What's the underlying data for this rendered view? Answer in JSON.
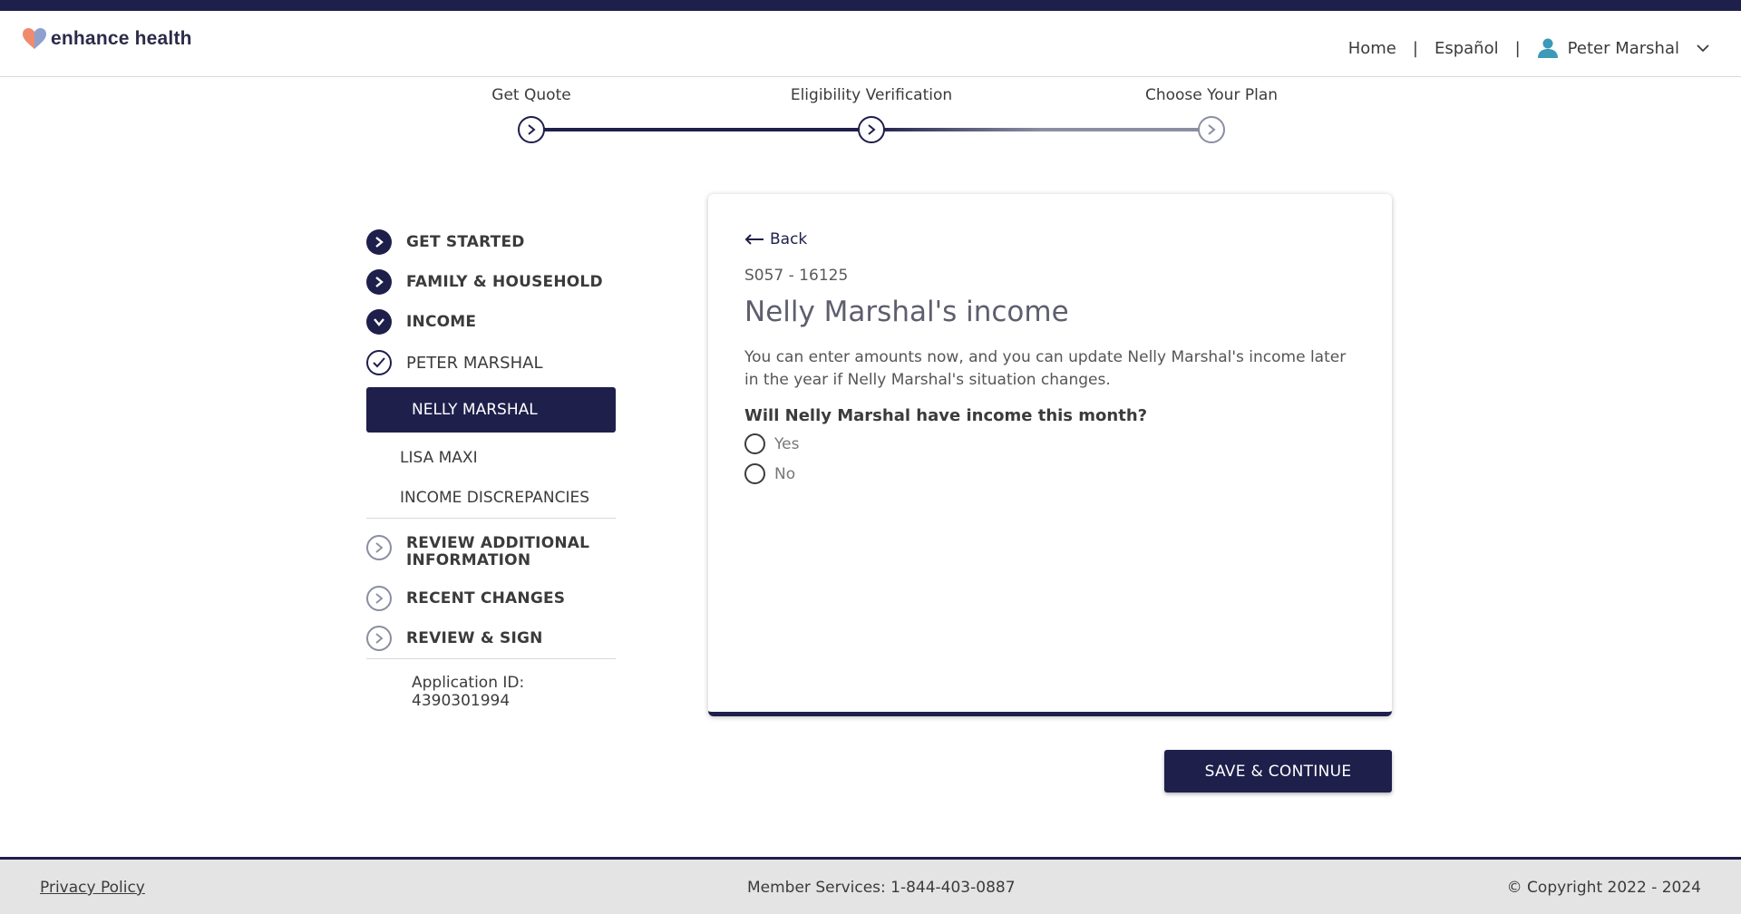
{
  "header": {
    "logo_text": "enhance health",
    "nav_home": "Home",
    "nav_language": "Español",
    "separator": "|",
    "user_name": "Peter Marshal"
  },
  "stepper": {
    "steps": [
      {
        "label": "Get Quote",
        "state": "complete"
      },
      {
        "label": "Eligibility Verification",
        "state": "current"
      },
      {
        "label": "Choose Your Plan",
        "state": "upcoming"
      }
    ]
  },
  "sidebar": {
    "sections": {
      "get_started": "GET STARTED",
      "family": "FAMILY & HOUSEHOLD",
      "income": "INCOME",
      "peter": "PETER MARSHAL",
      "nelly": "NELLY MARSHAL",
      "lisa": "LISA MAXI",
      "discrepancies": "INCOME DISCREPANCIES",
      "review_additional_1": "REVIEW ADDITIONAL",
      "review_additional_2": "INFORMATION",
      "recent_changes": "RECENT CHANGES",
      "review_sign": "REVIEW & SIGN"
    },
    "application_id": "Application ID: 4390301994"
  },
  "card": {
    "back_label": "Back",
    "code": "S057 - 16125",
    "title": "Nelly Marshal's income",
    "description": "You can enter amounts now, and you can update Nelly Marshal's income later in the year if Nelly Marshal's situation changes.",
    "question": "Will Nelly Marshal have income this month?",
    "options": [
      "Yes",
      "No"
    ]
  },
  "actions": {
    "save_continue": "SAVE & CONTINUE"
  },
  "footer": {
    "privacy": "Privacy Policy",
    "services": "Member Services: 1-844-403-0887",
    "copyright": "© Copyright 2022 - 2024"
  },
  "colors": {
    "brand_navy": "#1e1f4b",
    "inactive_gray": "#8a8ea0",
    "logo_orange": "#f08a6c",
    "logo_blue": "#7b8fc4",
    "user_icon": "#3a9ab8"
  }
}
